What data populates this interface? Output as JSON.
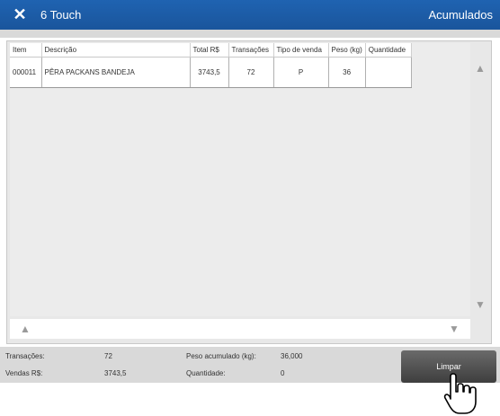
{
  "header": {
    "title": "6 Touch",
    "right_label": "Acumulados"
  },
  "table": {
    "columns": [
      "Item",
      "Descrição",
      "Total  R$",
      "Transações",
      "Tipo de venda",
      "Peso (kg)",
      "Quantidade"
    ],
    "rows": [
      [
        "000011",
        "PÊRA PACKANS BANDEJA",
        "3743,5",
        "72",
        "P",
        "36",
        ""
      ]
    ]
  },
  "summary": {
    "transacoes_label": "Transações:",
    "transacoes_value": "72",
    "peso_label": "Peso acumulado (kg):",
    "peso_value": "36,000",
    "vendas_label": "Vendas  R$:",
    "vendas_value": "3743,5",
    "quantidade_label": "Quantidade:",
    "quantidade_value": "0"
  },
  "buttons": {
    "limpar": "Limpar"
  },
  "icons": {
    "close": "close-icon",
    "hand": "hand-pointer-icon"
  }
}
